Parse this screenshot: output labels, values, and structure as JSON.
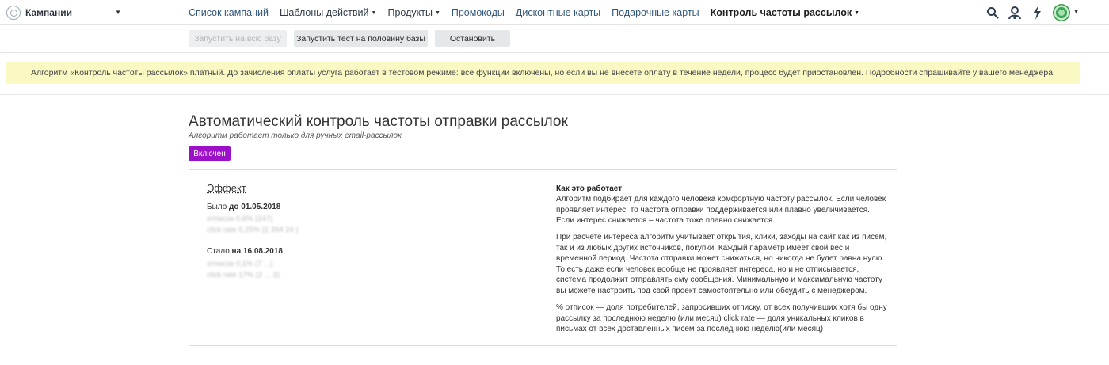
{
  "header": {
    "selector_label": "Кампании",
    "nav": [
      {
        "label": "Список кампаний",
        "kind": "link"
      },
      {
        "label": "Шаблоны действий",
        "kind": "dropdown"
      },
      {
        "label": "Продукты",
        "kind": "dropdown"
      },
      {
        "label": "Промокоды",
        "kind": "link"
      },
      {
        "label": "Дисконтные карты",
        "kind": "link"
      },
      {
        "label": "Подарочные карты",
        "kind": "link"
      },
      {
        "label": "Контроль частоты рассылок",
        "kind": "active-dropdown"
      }
    ],
    "icons": [
      "search-icon",
      "user-support-icon",
      "lightning-icon",
      "avatar"
    ]
  },
  "actions": {
    "run_all": "Запустить на всю базу",
    "run_half": "Запустить тест на половину базы",
    "stop": "Остановить"
  },
  "banner": {
    "text": "Алгоритм «Контроль частоты рассылок» платный. До зачисления оплаты услуга работает в тестовом режиме: все функции включены, но если вы не внесете оплату в течение недели, процесс будет приостановлен. Подробности спрашивайте у вашего менеджера."
  },
  "main": {
    "title": "Автоматический контроль частоты отправки рассылок",
    "subtitle": "Алгоритм работает только для ручных email-рассылок",
    "status_badge": "Включен"
  },
  "effect": {
    "title": "Эффект",
    "was_prefix": "Было",
    "was_date": "до 01.05.2018",
    "was_unsub": "отписок 0,6% (247)",
    "was_click": "click rate 0,25% (1 394 24 )",
    "now_prefix": "Стало",
    "now_date": "на 16.08.2018",
    "now_unsub": "отписок 0,1% (7 ...)",
    "now_click": "click rate 17% (2 ... 3)"
  },
  "how": {
    "title": "Как это работает",
    "p1": "Алгоритм подбирает для каждого человека комфортную частоту рассылок. Если человек проявляет интерес, то частота отправки поддерживается или плавно увеличивается. Если интерес снижается – частота тоже плавно снижается.",
    "p2": "При расчете интереса алгоритм учитывает открытия, клики, заходы на сайт как из писем, так и из любых других источников, покупки. Каждый параметр имеет свой вес и временной период. Частота отправки может снижаться, но никогда не будет равна нулю. То есть даже если человек вообще не проявляет интереса, но и не отписывается, система продолжит отправлять ему сообщения. Минимальную и максимальную частоту вы можете настроить под свой проект самостоятельно или обсудить с менеджером.",
    "p3": "% отписок — доля потребителей, запросивших отписку, от всех получивших хотя бы одну рассылку за последнюю неделю (или месяц) click rate — доля уникальных кликов в письмах от всех доставленных писем за последнюю неделю(или месяц)"
  },
  "colors": {
    "badge": "#9c10c8",
    "banner": "#faf8c3",
    "link": "#31567a"
  }
}
